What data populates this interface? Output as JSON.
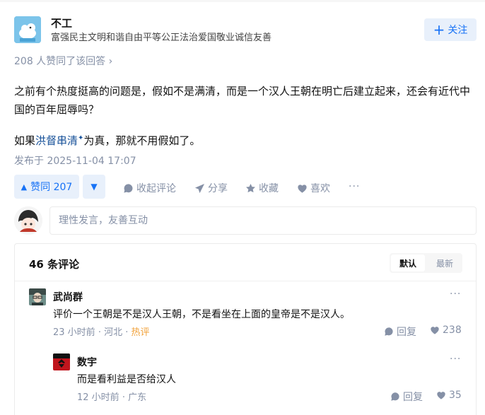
{
  "author": {
    "name": "不工",
    "bio": "富强民主文明和谐自由平等公正法治爱国敬业诚信友善",
    "follow_label": "关注"
  },
  "answer": {
    "upvoted_by": "208 人赞同了该回答",
    "paragraph1": "之前有个热度挺高的问题是，假如不是满清，而是一个汉人王朝在明亡后建立起来，还会有近代中国的百年屈辱吗？",
    "paragraph2_prefix": "如果",
    "paragraph2_link": "洪督串清",
    "paragraph2_suffix": "为真，那就不用假如了。",
    "published": "发布于 2025-11-04 17:07"
  },
  "actions": {
    "upvote_label": "赞同 207",
    "collapse_comments": "收起评论",
    "share": "分享",
    "favorite": "收藏",
    "like": "喜欢"
  },
  "comment_input": {
    "placeholder": "理性发言，友善互动"
  },
  "comments": {
    "title": "46 条评论",
    "sort_default": "默认",
    "sort_latest": "最新",
    "items": [
      {
        "name": "武尚群",
        "text": "评价一个王朝是不是汉人王朝，不是看坐在上面的皇帝是不是汉人。",
        "time": "23 小时前",
        "location": "河北",
        "badge": "热评",
        "reply": "回复",
        "likes": "238"
      },
      {
        "name": "数宇",
        "text": "而是看利益是否给汉人",
        "time": "12 小时前",
        "location": "广东",
        "reply": "回复",
        "likes": "35"
      }
    ]
  },
  "colors": {
    "accent": "#1772f6",
    "accent_bg": "#e8f0fb",
    "muted": "#8590a6",
    "hot": "#f1a23b"
  }
}
